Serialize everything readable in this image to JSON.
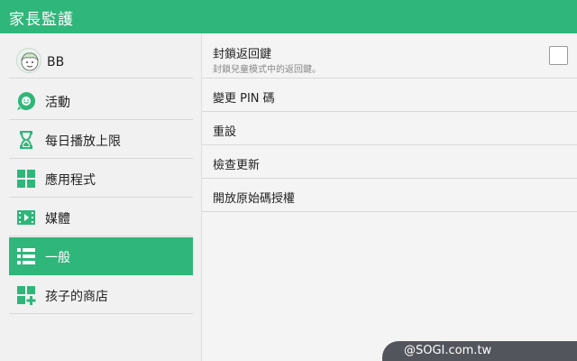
{
  "app": {
    "title": "家長監護"
  },
  "sidebar": {
    "profile": {
      "name": "BB",
      "icon": "child-avatar-icon"
    },
    "items": [
      {
        "label": "活動",
        "icon": "activity-face-icon"
      },
      {
        "label": "每日播放上限",
        "icon": "hourglass-icon"
      },
      {
        "label": "應用程式",
        "icon": "apps-grid-icon"
      },
      {
        "label": "媒體",
        "icon": "film-play-icon"
      },
      {
        "label": "一般",
        "icon": "list-icon",
        "active": true
      },
      {
        "label": "孩子的商店",
        "icon": "store-grid-plus-icon"
      }
    ]
  },
  "settings": {
    "back_key": {
      "title": "封鎖返回鍵",
      "subtitle": "封鎖兒童模式中的返回鍵。",
      "checked": false
    },
    "change_pin": "變更 PIN 碼",
    "reset": "重設",
    "check_update": "檢查更新",
    "open_source": "開放原始碼授權"
  },
  "watermark": "@SOGI.com.tw",
  "colors": {
    "accent": "#2fb67a",
    "background": "#f1f1f1"
  }
}
